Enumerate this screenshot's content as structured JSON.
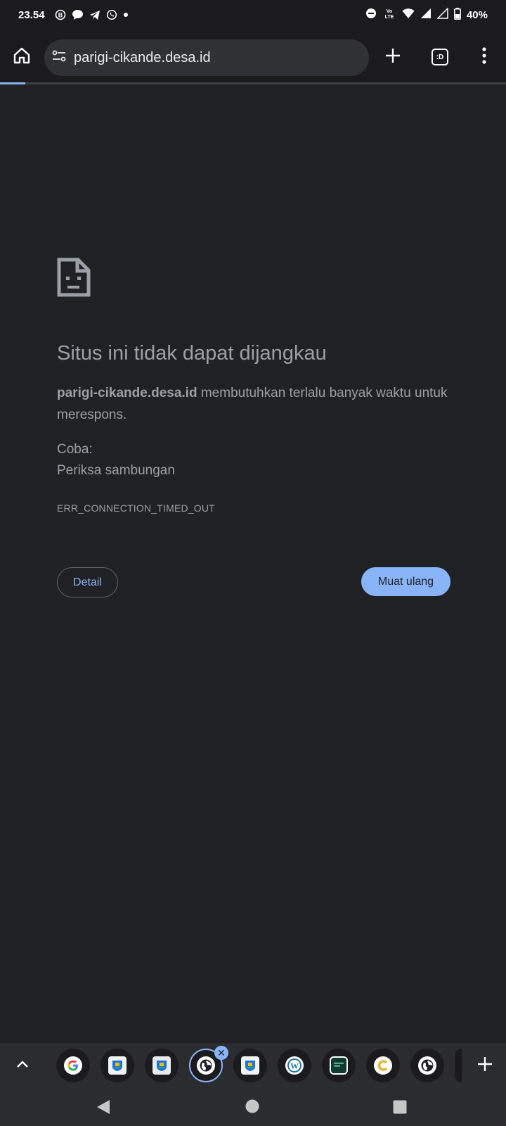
{
  "status_bar": {
    "time": "23.54",
    "battery": "40%",
    "network": "VoLTE"
  },
  "toolbar": {
    "url": "parigi-cikande.desa.id",
    "tab_switcher_label": ":D"
  },
  "page": {
    "progress_fraction": 0.05,
    "title": "Situs ini tidak dapat dijangkau",
    "host_bold": "parigi-cikande.desa.id",
    "desc_rest": " membutuhkan terlalu banyak waktu untuk merespons.",
    "try_label": "Coba:",
    "try_item": "Periksa sambungan",
    "error_code": "ERR_CONNECTION_TIMED_OUT",
    "detail_button": "Detail",
    "reload_button": "Muat ulang"
  },
  "tab_strip": {
    "tabs": [
      {
        "icon": "google-icon"
      },
      {
        "icon": "village-emblem-icon"
      },
      {
        "icon": "village-emblem-icon"
      },
      {
        "icon": "globe-icon",
        "active": true
      },
      {
        "icon": "village-emblem-icon"
      },
      {
        "icon": "wordpress-icon"
      },
      {
        "icon": "terminal-icon"
      },
      {
        "icon": "c-logo-icon"
      },
      {
        "icon": "globe-icon"
      }
    ]
  },
  "colors": {
    "background": "#202124",
    "accent": "#8ab4f8",
    "text": "#9aa0a6"
  }
}
